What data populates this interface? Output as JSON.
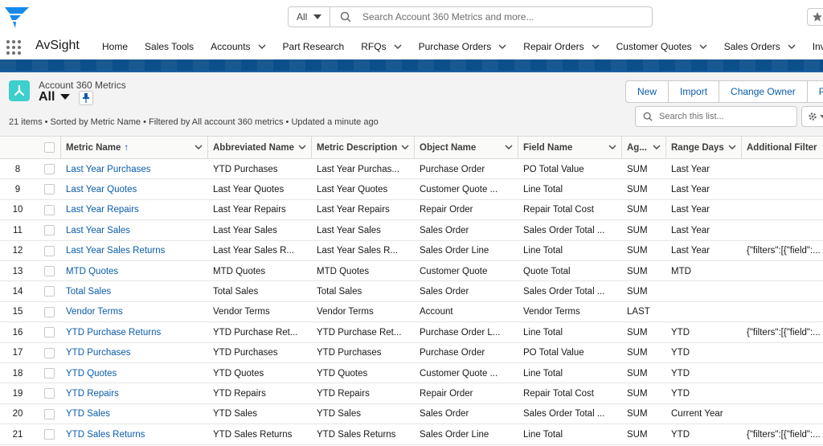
{
  "global_search": {
    "scope": "All",
    "placeholder": "Search Account 360 Metrics and more..."
  },
  "nav": {
    "app_name": "AvSight",
    "items": [
      {
        "label": "Home",
        "dropdown": false
      },
      {
        "label": "Sales Tools",
        "dropdown": false
      },
      {
        "label": "Accounts",
        "dropdown": true
      },
      {
        "label": "Part Research",
        "dropdown": false
      },
      {
        "label": "RFQs",
        "dropdown": true
      },
      {
        "label": "Purchase Orders",
        "dropdown": true
      },
      {
        "label": "Repair Orders",
        "dropdown": true
      },
      {
        "label": "Customer Quotes",
        "dropdown": true
      },
      {
        "label": "Sales Orders",
        "dropdown": true
      },
      {
        "label": "Inventory",
        "dropdown": false
      }
    ]
  },
  "list_header": {
    "object_name": "Account 360 Metrics",
    "view_name": "All",
    "meta": "21 items • Sorted by Metric Name • Filtered by All account 360 metrics • Updated a minute ago",
    "buttons": [
      "New",
      "Import",
      "Change Owner",
      "Pr"
    ],
    "search_placeholder": "Search this list..."
  },
  "table": {
    "columns": [
      "Metric Name",
      "Abbreviated Name",
      "Metric Description",
      "Object Name",
      "Field Name",
      "Ag...",
      "Range Days",
      "Additional Filter"
    ],
    "sort_indicator": "↑",
    "rows": [
      [
        "8",
        "Last Year Purchases",
        "YTD Purchases",
        "Last Year Purchas...",
        "Purchase Order",
        "PO Total Value",
        "SUM",
        "Last Year",
        ""
      ],
      [
        "9",
        "Last Year Quotes",
        "Last Year Quotes",
        "Last Year Quotes",
        "Customer Quote ...",
        "Line Total",
        "SUM",
        "Last Year",
        ""
      ],
      [
        "10",
        "Last Year Repairs",
        "Last Year Repairs",
        "Last Year Repairs",
        "Repair Order",
        "Repair Total Cost",
        "SUM",
        "Last Year",
        ""
      ],
      [
        "11",
        "Last Year Sales",
        "Last Year Sales",
        "Last Year Sales",
        "Sales Order",
        "Sales Order Total ...",
        "SUM",
        "Last Year",
        ""
      ],
      [
        "12",
        "Last Year Sales Returns",
        "Last Year Sales R...",
        "Last Year Sales R...",
        "Sales Order Line",
        "Line Total",
        "SUM",
        "Last Year",
        "{\"filters\":[{\"field\":..."
      ],
      [
        "13",
        "MTD Quotes",
        "MTD Quotes",
        "MTD Quotes",
        "Customer Quote",
        "Quote Total",
        "SUM",
        "MTD",
        ""
      ],
      [
        "14",
        "Total Sales",
        "Total Sales",
        "Total Sales",
        "Sales Order",
        "Sales Order Total ...",
        "SUM",
        "",
        ""
      ],
      [
        "15",
        "Vendor Terms",
        "Vendor Terms",
        "Vendor Terms",
        "Account",
        "Vendor Terms",
        "LAST",
        "",
        ""
      ],
      [
        "16",
        "YTD Purchase Returns",
        "YTD Purchase Ret...",
        "YTD Purchase Ret...",
        "Purchase Order L...",
        "Line Total",
        "SUM",
        "YTD",
        "{\"filters\":[{\"field\":..."
      ],
      [
        "17",
        "YTD Purchases",
        "YTD Purchases",
        "YTD Purchases",
        "Purchase Order",
        "PO Total Value",
        "SUM",
        "YTD",
        ""
      ],
      [
        "18",
        "YTD Quotes",
        "YTD Quotes",
        "YTD Quotes",
        "Customer Quote ...",
        "Line Total",
        "SUM",
        "YTD",
        ""
      ],
      [
        "19",
        "YTD Repairs",
        "YTD Repairs",
        "YTD Repairs",
        "Repair Order",
        "Repair Total Cost",
        "SUM",
        "YTD",
        ""
      ],
      [
        "20",
        "YTD Sales",
        "YTD Sales",
        "YTD Sales",
        "Sales Order",
        "Sales Order Total ...",
        "SUM",
        "Current Year",
        ""
      ],
      [
        "21",
        "YTD Sales Returns",
        "YTD Sales Returns",
        "YTD Sales Returns",
        "Sales Order Line",
        "Line Total",
        "SUM",
        "YTD",
        "{\"filters\":[{\"field\":..."
      ]
    ]
  },
  "colors": {
    "link": "#0b5cab",
    "brand_band": "#0b4f8b",
    "object_icon": "#3ccfcb",
    "logo": "#1589ee"
  },
  "icons": [
    "app-logo-icon",
    "chevron-down-icon",
    "search-icon",
    "star-icon",
    "waffle-icon",
    "list-object-icon",
    "pin-icon",
    "gear-icon",
    "sort-up-icon"
  ]
}
